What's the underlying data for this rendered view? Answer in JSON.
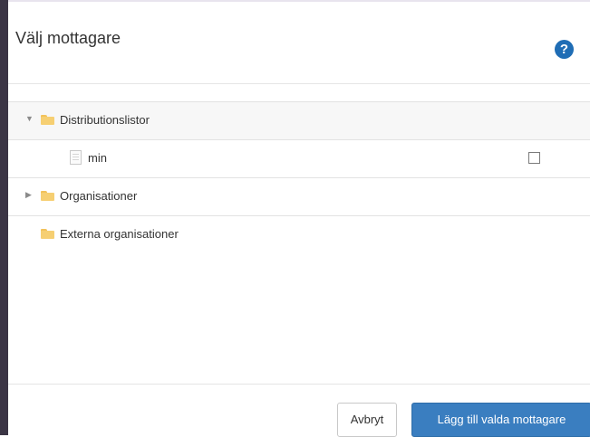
{
  "dialog": {
    "title": "Välj mottagare",
    "help_icon": "question-circle-icon",
    "help_symbol": "?"
  },
  "tree": {
    "items": [
      {
        "label": "Distributionslistor",
        "icon": "folder-icon",
        "state": "expanded"
      },
      {
        "label": "min",
        "icon": "document-icon",
        "checked": false
      },
      {
        "label": "Organisationer",
        "icon": "folder-icon",
        "state": "collapsed"
      },
      {
        "label": "Externa organisationer",
        "icon": "folder-icon",
        "state": "leaf"
      }
    ]
  },
  "footer": {
    "cancel_label": "Avbryt",
    "confirm_label": "Lägg till valda mottagare"
  },
  "colors": {
    "primary": "#3a7ec0",
    "help": "#1f6db5",
    "folder": "#f6cf72"
  }
}
